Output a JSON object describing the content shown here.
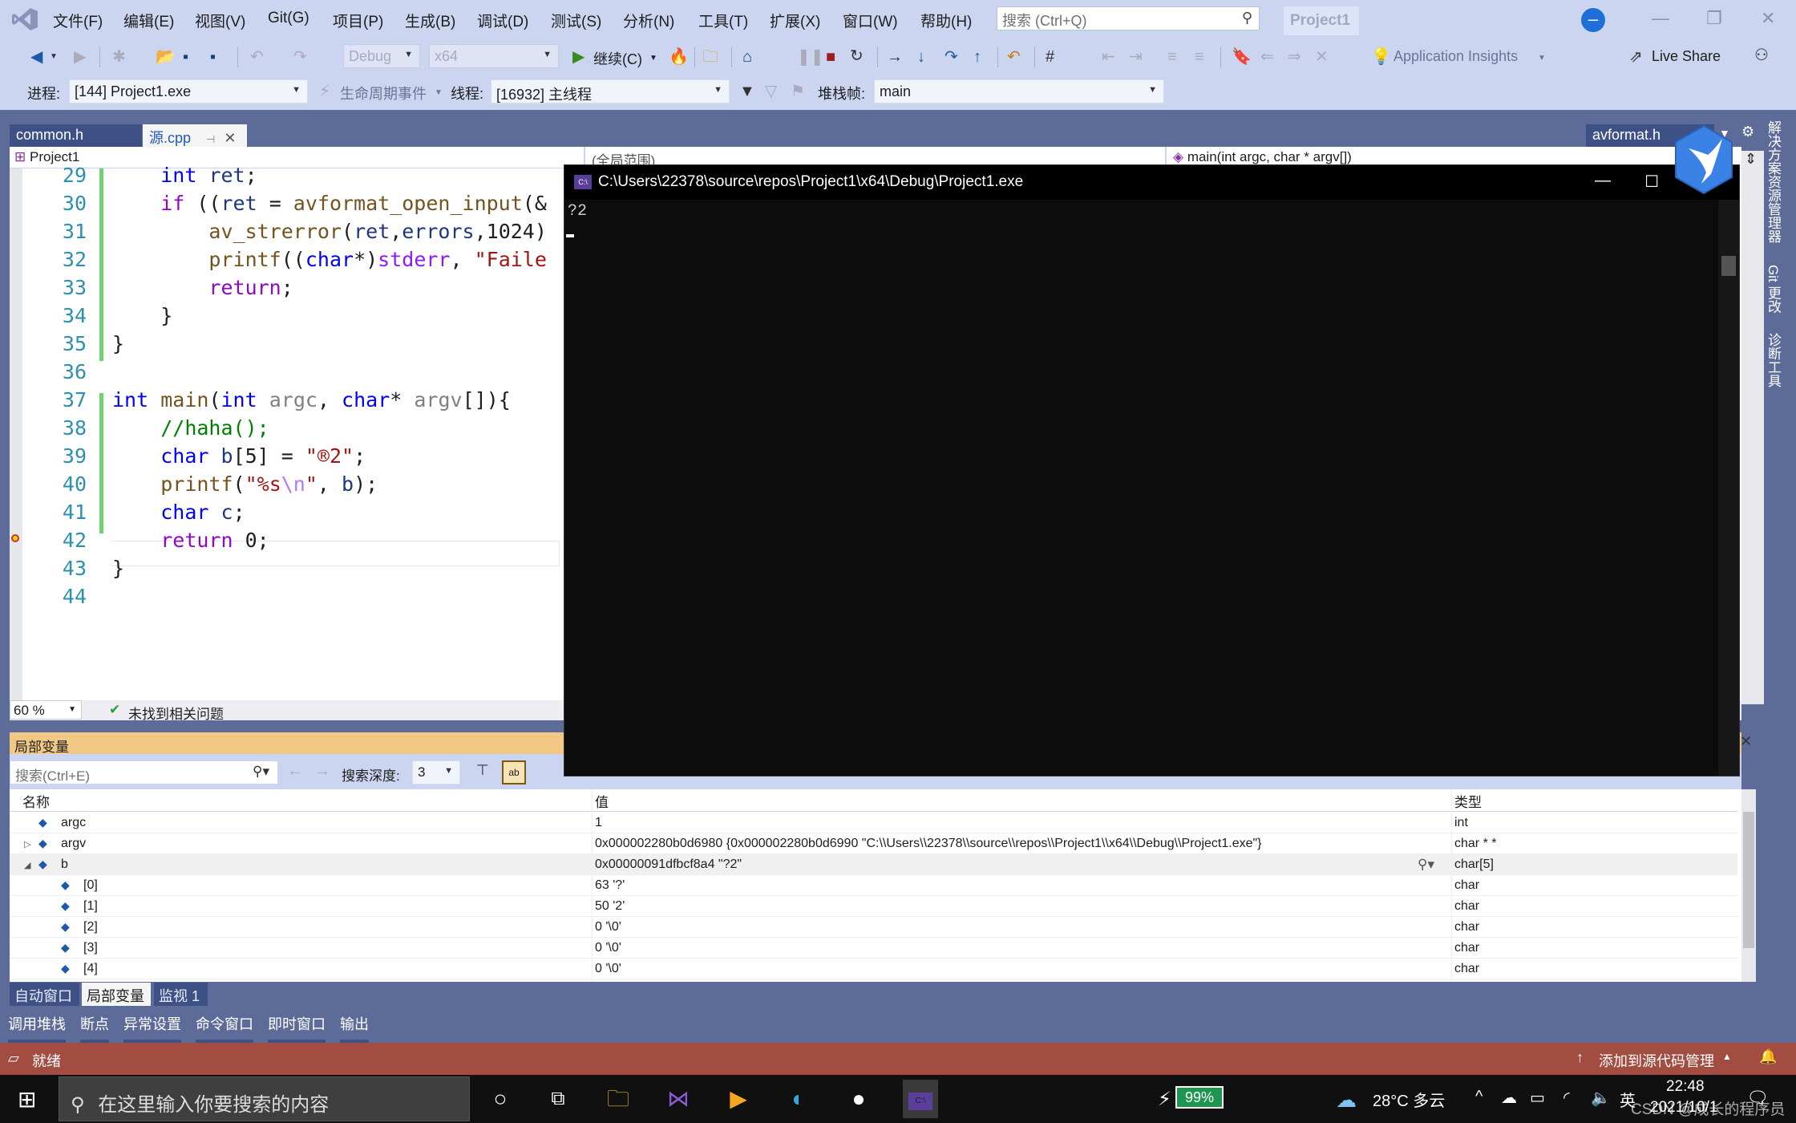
{
  "menubar": {
    "items": [
      "文件(F)",
      "编辑(E)",
      "视图(V)",
      "Git(G)",
      "项目(P)",
      "生成(B)",
      "调试(D)",
      "测试(S)",
      "分析(N)",
      "工具(T)",
      "扩展(X)",
      "窗口(W)",
      "帮助(H)"
    ],
    "search_placeholder": "搜索 (Ctrl+Q)",
    "project_title": "Project1"
  },
  "toolbar": {
    "config": "Debug",
    "platform": "x64",
    "continue_label": "继续(C)",
    "app_insights_label": "Application Insights",
    "live_share_label": "Live Share"
  },
  "debug_toolbar": {
    "process_label": "进程:",
    "process_value": "[144] Project1.exe",
    "lifecycle_label": "生命周期事件",
    "thread_label": "线程:",
    "thread_value": "[16932] 主线程",
    "stackframe_label": "堆栈帧:",
    "stackframe_value": "main"
  },
  "doc_tabs": [
    {
      "label": "common.h",
      "active": false
    },
    {
      "label": "源.cpp",
      "active": true
    }
  ],
  "right_doc_tab": "avformat.h",
  "navbar": {
    "project": "Project1",
    "scope": "(全局范围)",
    "member": "main(int argc, char * argv[])"
  },
  "editor": {
    "lines": [
      {
        "num": "29",
        "html": "    <span class='kw'>int</span> <span class='var'>ret</span>;"
      },
      {
        "num": "30",
        "html": "    <span class='ctrl'>if</span> ((<span class='var'>ret</span> = <span class='fn'>avformat_open_input</span>(&amp;"
      },
      {
        "num": "31",
        "html": "        <span class='fn'>av_strerror</span>(<span class='var'>ret</span>,<span class='var'>errors</span>,1024)"
      },
      {
        "num": "32",
        "html": "        <span class='fn'>printf</span>((<span class='kw'>char</span>*)<span class='glb'>stderr</span>, <span class='str'>\"Faile</span>"
      },
      {
        "num": "33",
        "html": "        <span class='ctrl'>return</span>;"
      },
      {
        "num": "34",
        "html": "    }"
      },
      {
        "num": "35",
        "html": "}"
      },
      {
        "num": "36",
        "html": ""
      },
      {
        "num": "37",
        "html": "<span class='kw'>int</span> <span class='fn'>main</span>(<span class='kw'>int</span> <span class='par'>argc</span>, <span class='kw'>char</span>* <span class='par'>argv</span>[]){"
      },
      {
        "num": "38",
        "html": "    <span class='cm'>//haha();</span>"
      },
      {
        "num": "39",
        "html": "    <span class='kw'>char</span> <span class='var'>b</span>[5] = <span class='str'>\"®2\"</span>;"
      },
      {
        "num": "40",
        "html": "    <span class='fn'>printf</span>(<span class='str'>\"%s</span><span class='esc'>\\n</span><span class='str'>\"</span>, <span class='var'>b</span>);"
      },
      {
        "num": "41",
        "html": "    <span class='kw'>char</span> <span class='var'>c</span>;"
      },
      {
        "num": "42",
        "html": "    <span class='ctrl'>return</span> 0;"
      },
      {
        "num": "43",
        "html": "}"
      },
      {
        "num": "44",
        "html": ""
      }
    ],
    "zoom": "60 %",
    "issues": "未找到相关问题"
  },
  "console": {
    "title": "C:\\Users\\22378\\source\\repos\\Project1\\x64\\Debug\\Project1.exe",
    "output": "?2"
  },
  "right_sidebar": [
    "解决方案资源管理器",
    "Git 更改",
    "诊断工具"
  ],
  "locals": {
    "title": "局部变量",
    "search_placeholder": "搜索(Ctrl+E)",
    "depth_label": "搜索深度:",
    "depth_value": "3",
    "columns": [
      "名称",
      "值",
      "类型"
    ],
    "rows": [
      {
        "name": "argc",
        "value": "1",
        "type": "int",
        "indent": 0,
        "expander": ""
      },
      {
        "name": "argv",
        "value": "0x000002280b0d6980 {0x000002280b0d6990 \"C:\\\\Users\\\\22378\\\\source\\\\repos\\\\Project1\\\\x64\\\\Debug\\\\Project1.exe\"}",
        "type": "char * *",
        "indent": 0,
        "expander": "▷"
      },
      {
        "name": "b",
        "value": "0x00000091dfbcf8a4 \"?2\"",
        "type": "char[5]",
        "indent": 0,
        "expander": "◢"
      },
      {
        "name": "[0]",
        "value": "63 '?'",
        "type": "char",
        "indent": 1,
        "expander": ""
      },
      {
        "name": "[1]",
        "value": "50 '2'",
        "type": "char",
        "indent": 1,
        "expander": ""
      },
      {
        "name": "[2]",
        "value": "0 '\\0'",
        "type": "char",
        "indent": 1,
        "expander": ""
      },
      {
        "name": "[3]",
        "value": "0 '\\0'",
        "type": "char",
        "indent": 1,
        "expander": ""
      },
      {
        "name": "[4]",
        "value": "0 '\\0'",
        "type": "char",
        "indent": 1,
        "expander": ""
      }
    ]
  },
  "bottom_tabs": [
    {
      "label": "自动窗口",
      "active": false
    },
    {
      "label": "局部变量",
      "active": true
    },
    {
      "label": "监视 1",
      "active": false
    }
  ],
  "tool_tabs": [
    "调用堆栈",
    "断点",
    "异常设置",
    "命令窗口",
    "即时窗口",
    "输出"
  ],
  "statusbar": {
    "ready": "就绪",
    "source_control": "添加到源代码管理"
  },
  "taskbar": {
    "search_placeholder": "在这里输入你要搜索的内容",
    "battery": "99%",
    "weather": "28°C 多云",
    "ime": "英",
    "time": "22:48",
    "date": "2021/10/1",
    "watermark": "CSDN @成长的程序员"
  },
  "colors": {
    "statusbar": "#a34c42",
    "locals_title": "#f2c984",
    "chrome": "#ccd5f0",
    "frame": "#5d6b99"
  }
}
